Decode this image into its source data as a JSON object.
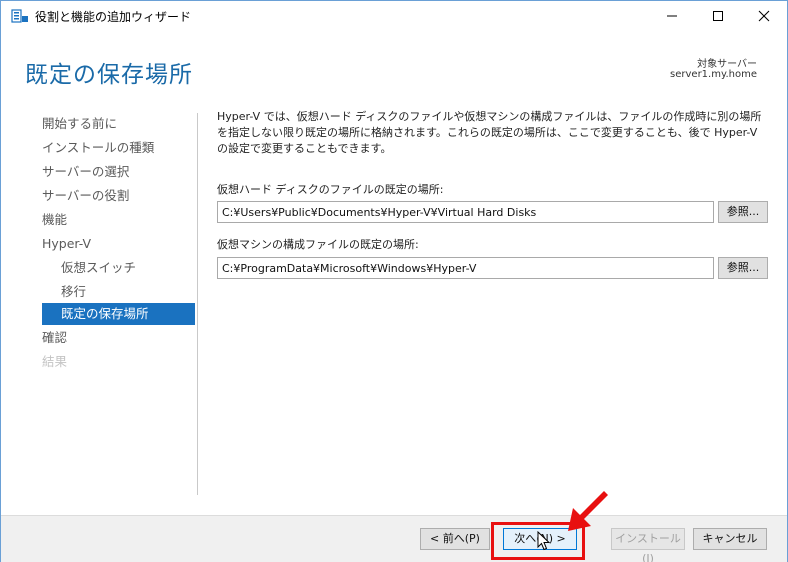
{
  "window": {
    "title": "役割と機能の追加ウィザード",
    "minimize_label": "—",
    "maximize_label": "☐",
    "close_label": "✕"
  },
  "header": {
    "page_title": "既定の保存場所",
    "target_label": "対象サーバー",
    "target_server": "server1.my.home"
  },
  "nav": {
    "items": [
      {
        "label": "開始する前に"
      },
      {
        "label": "インストールの種類"
      },
      {
        "label": "サーバーの選択"
      },
      {
        "label": "サーバーの役割"
      },
      {
        "label": "機能"
      },
      {
        "label": "Hyper-V"
      },
      {
        "label": "仮想スイッチ"
      },
      {
        "label": "移行"
      },
      {
        "label": "既定の保存場所"
      },
      {
        "label": "確認"
      },
      {
        "label": "結果"
      }
    ]
  },
  "content": {
    "description": "Hyper-V では、仮想ハード ディスクのファイルや仮想マシンの構成ファイルは、ファイルの作成時に別の場所を指定しない限り既定の場所に格納されます。これらの既定の場所は、ここで変更することも、後で Hyper-V の設定で変更することもできます。",
    "vhd_label": "仮想ハード ディスクのファイルの既定の場所:",
    "vhd_path": "C:¥Users¥Public¥Documents¥Hyper-V¥Virtual Hard Disks",
    "vm_label": "仮想マシンの構成ファイルの既定の場所:",
    "vm_path": "C:¥ProgramData¥Microsoft¥Windows¥Hyper-V",
    "browse_label": "参照..."
  },
  "footer": {
    "prev_label": "< 前へ(P)",
    "next_label": "次へ(N) >",
    "install_label": "インストール(I)",
    "cancel_label": "キャンセル"
  },
  "colors": {
    "accent": "#1a72c0",
    "title_blue": "#1a6aa8",
    "highlight_red": "#e81010"
  }
}
